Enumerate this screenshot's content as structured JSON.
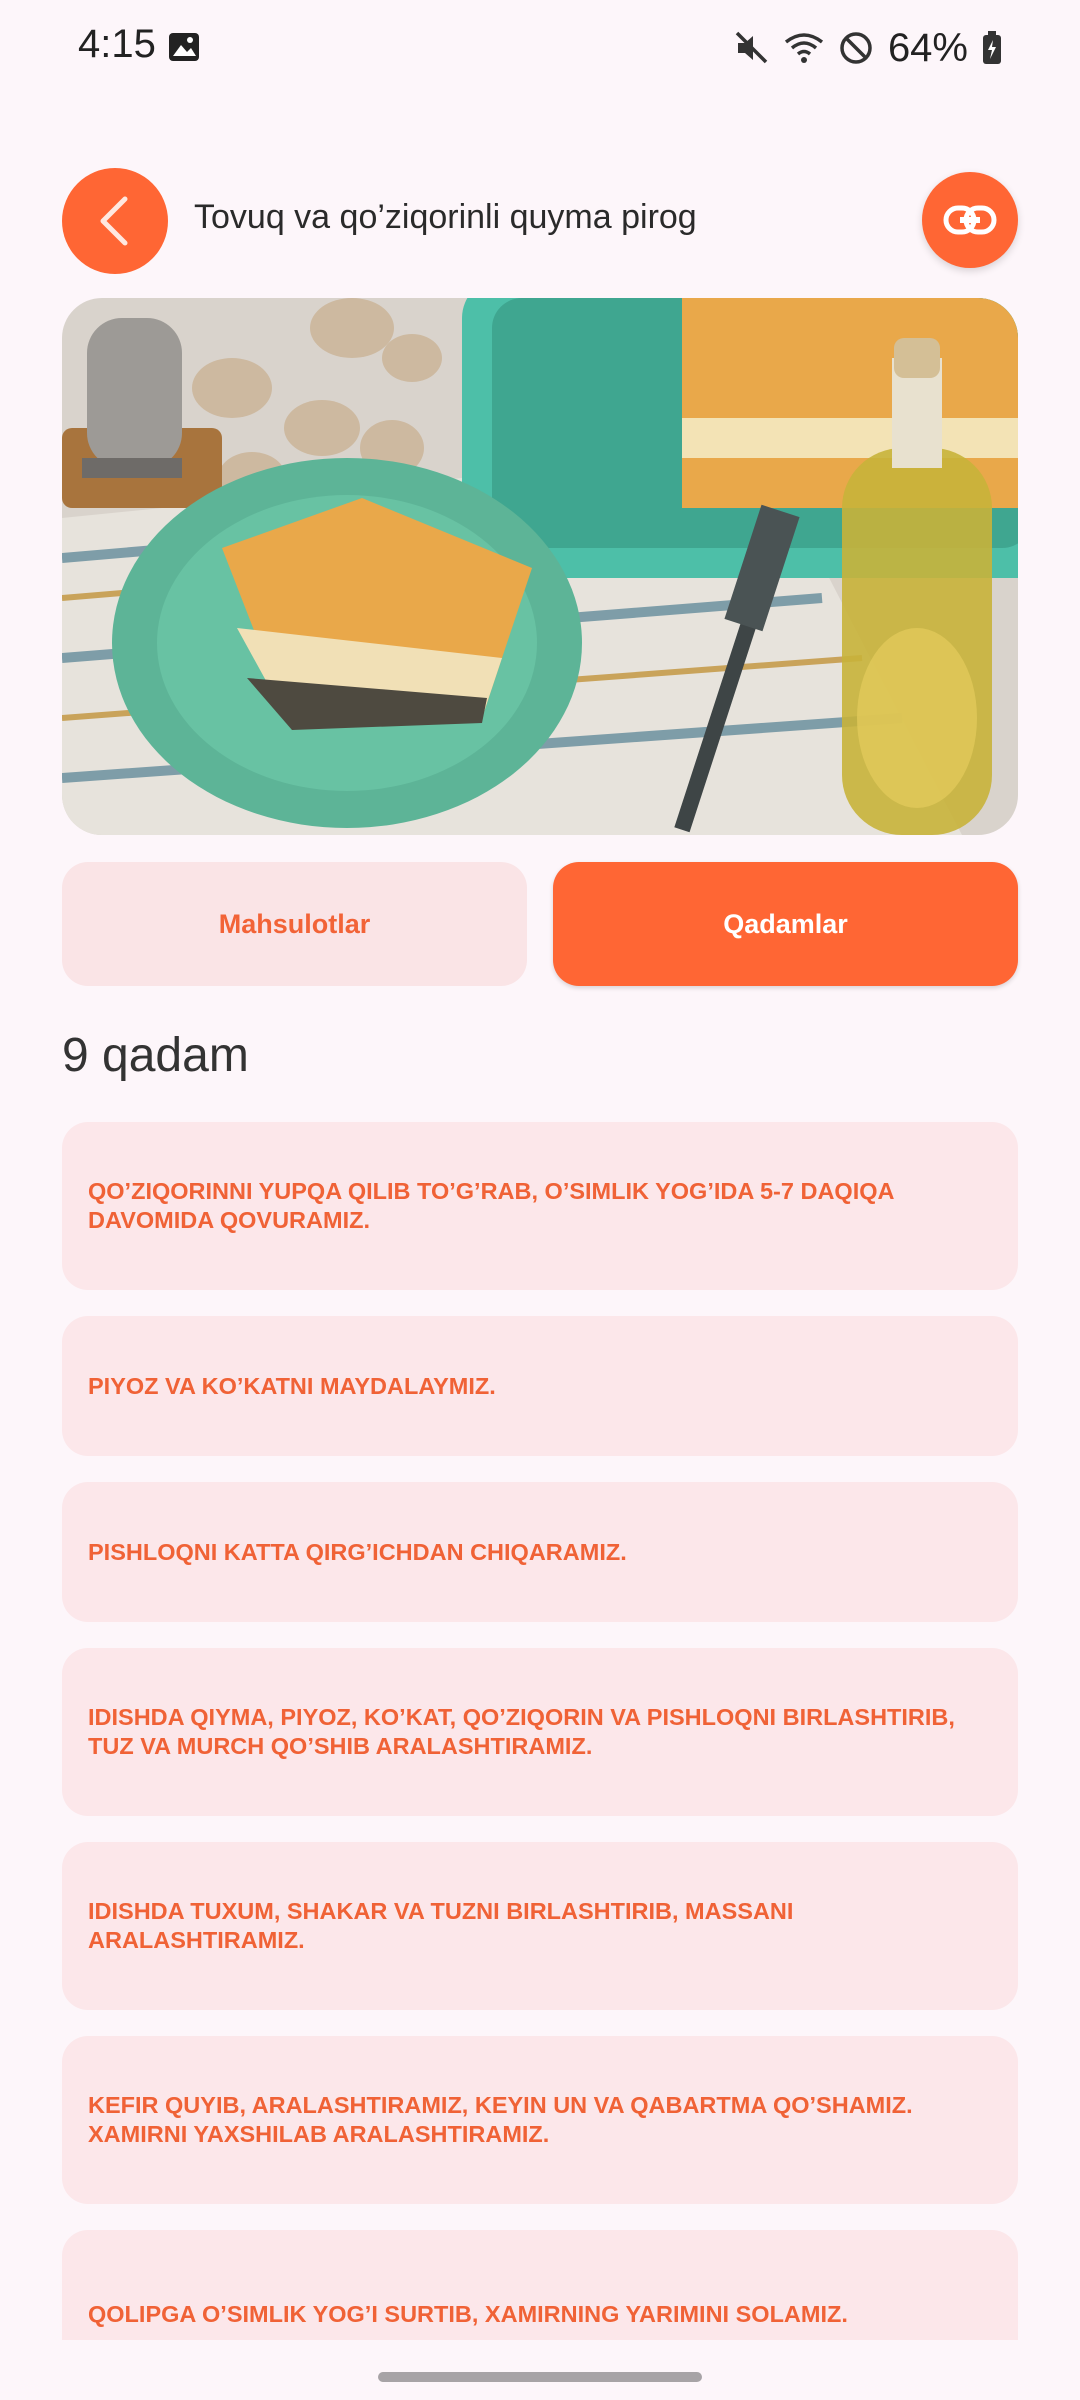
{
  "status_bar": {
    "time": "4:15",
    "battery": "64%"
  },
  "header": {
    "title": "Tovuq va qo’ziqorinli quyma pirog"
  },
  "tabs": [
    {
      "label": "Mahsulotlar",
      "active": false
    },
    {
      "label": "Qadamlar",
      "active": true
    }
  ],
  "steps_count": "9 qadam",
  "steps": [
    "QO’ZIQORINNI YUPQA QILIB TO’G’RAB, O’SIMLIK YOG’IDA 5-7 DAQIQA DAVOMIDA QOVURAMIZ.",
    "PIYOZ VA KO’KATNI MAYDALAYMIZ.",
    "PISHLOQNI KATTA QIRG’ICHDAN CHIQARAMIZ.",
    "IDISHDA QIYMA, PIYOZ, KO’KAT, QO’ZIQORIN VA PISHLOQNI BIRLASHTIRIB, TUZ VA MURCH QO’SHIB ARALASHTIRAMIZ.",
    "IDISHDA TUXUM, SHAKAR VA TUZNI BIRLASHTIRIB, MASSANI ARALASHTIRAMIZ.",
    "KEFIR QUYIB, ARALASHTIRAMIZ, KEYIN UN VA QABARTMA QO’SHAMIZ. XAMIRNI YAXSHILAB ARALASHTIRAMIZ.",
    "QOLIPGA O’SIMLIK YOG’I SURTIB, XAMIRNING YARIMINI SOLAMIZ."
  ],
  "colors": {
    "accent": "#FF6634",
    "tab_inactive_bg": "#FAE4E6",
    "card_bg": "#FCE7EA",
    "step_text": "#F06236"
  },
  "icons": [
    "back-arrow-icon",
    "link-icon",
    "image-icon",
    "mute-icon",
    "wifi-icon",
    "do-not-disturb-icon",
    "battery-icon"
  ]
}
